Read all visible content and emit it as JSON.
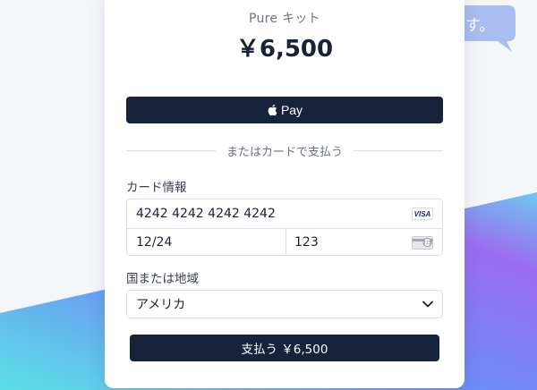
{
  "background": {
    "bubble_text": "す。"
  },
  "checkout": {
    "product_name": "Pure キット",
    "amount": "￥6,500",
    "apple_pay_label": "Pay",
    "divider_text": "またはカードで支払う",
    "card_section_label": "カード情報",
    "card_number_value": "4242 4242 4242 4242",
    "card_brand": "VISA",
    "expiry_value": "12/24",
    "cvc_value": "123",
    "country_label": "国または地域",
    "country_value": "アメリカ",
    "pay_button_label": "支払う ￥6,500"
  },
  "colors": {
    "button_bg": "#16233b",
    "card_bg": "#ffffff"
  }
}
